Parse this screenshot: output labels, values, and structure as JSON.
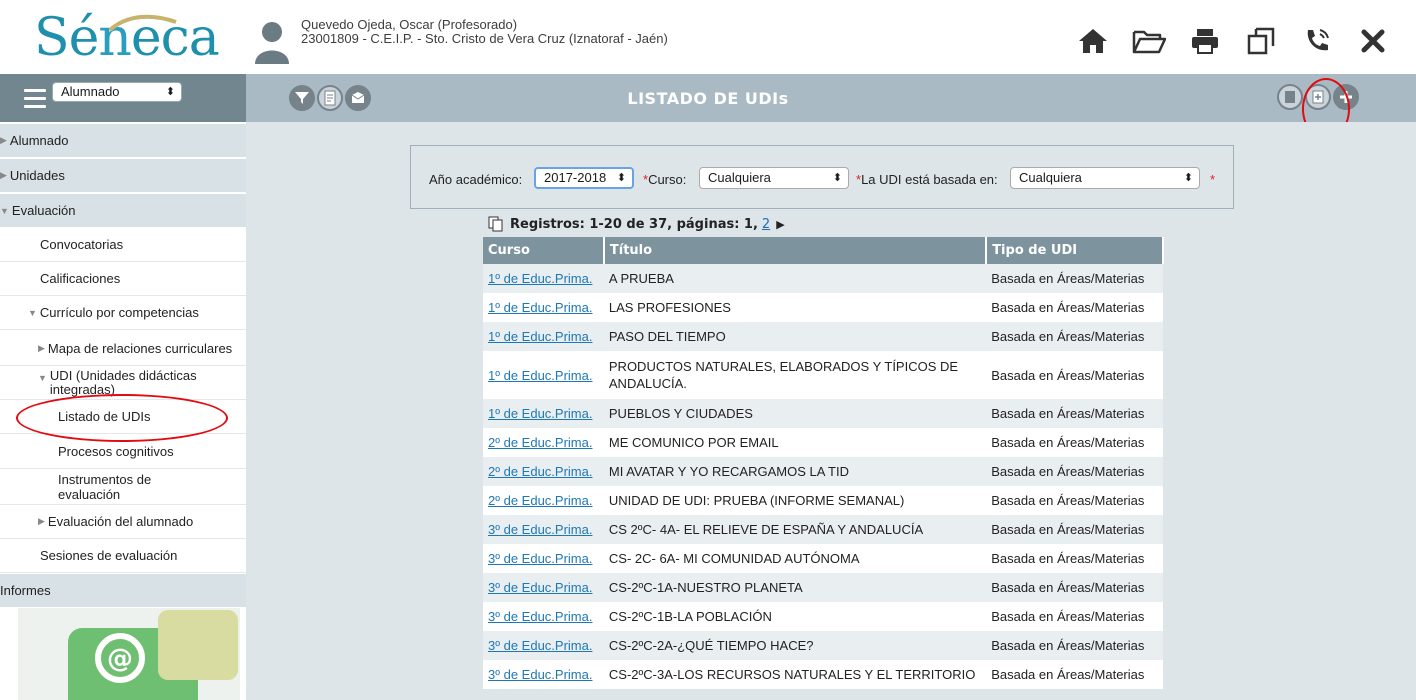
{
  "app": {
    "logo_text": "Séneca"
  },
  "user": {
    "name": "Quevedo Ojeda, Oscar (Profesorado)",
    "center": "23001809 - C.E.I.P. - Sto. Cristo de Vera Cruz (Iznatoraf - Jaén)"
  },
  "header_icons": [
    "home-icon",
    "folder-open-icon",
    "print-icon",
    "windows-icon",
    "phone-icon",
    "close-icon"
  ],
  "toolbar": {
    "module_select": "Alumnado",
    "page_title": "LISTADO DE UDIs",
    "left_tools": [
      "filter-icon",
      "export-pdf-xls-icon",
      "message-icon"
    ],
    "right_tools": [
      "document-icon",
      "new-document-icon",
      "add-icon"
    ]
  },
  "sidebar": {
    "items": [
      {
        "label": "Alumnado"
      },
      {
        "label": "Unidades"
      },
      {
        "label": "Evaluación"
      },
      {
        "label": "Convocatorias"
      },
      {
        "label": "Calificaciones"
      },
      {
        "label": "Currículo por competencias"
      },
      {
        "label": "Mapa de relaciones curriculares"
      },
      {
        "label": "UDI (Unidades didácticas integradas)"
      },
      {
        "label": "Listado de UDIs"
      },
      {
        "label": "Procesos cognitivos"
      },
      {
        "label": "Instrumentos de evaluación"
      },
      {
        "label": "Evaluación del alumnado"
      },
      {
        "label": "Sesiones de evaluación"
      },
      {
        "label": "Informes"
      }
    ]
  },
  "filters": {
    "year_label": "Año académico:",
    "year_value": "2017-2018",
    "course_label": "Curso:",
    "course_value": "Cualquiera",
    "basis_label": "La UDI está basada en:",
    "basis_value": "Cualquiera",
    "required_mark": "*"
  },
  "pager": {
    "text": "Registros: 1-20 de 37, páginas: 1,",
    "next_page": "2"
  },
  "table": {
    "headers": [
      "Curso",
      "Título",
      "Tipo de UDI"
    ],
    "rows": [
      {
        "curso": "1º de Educ.Prima.",
        "titulo": "A PRUEBA",
        "tipo": "Basada en Áreas/Materias"
      },
      {
        "curso": "1º de Educ.Prima.",
        "titulo": "LAS PROFESIONES",
        "tipo": "Basada en Áreas/Materias"
      },
      {
        "curso": "1º de Educ.Prima.",
        "titulo": "PASO DEL TIEMPO",
        "tipo": "Basada en Áreas/Materias"
      },
      {
        "curso": "1º de Educ.Prima.",
        "titulo": "PRODUCTOS NATURALES, ELABORADOS Y TÍPICOS DE ANDALUCÍA.",
        "tipo": "Basada en Áreas/Materias"
      },
      {
        "curso": "1º de Educ.Prima.",
        "titulo": "PUEBLOS Y CIUDADES",
        "tipo": "Basada en Áreas/Materias"
      },
      {
        "curso": "2º de Educ.Prima.",
        "titulo": "ME COMUNICO POR EMAIL",
        "tipo": "Basada en Áreas/Materias"
      },
      {
        "curso": "2º de Educ.Prima.",
        "titulo": "MI AVATAR Y YO RECARGAMOS LA TID",
        "tipo": "Basada en Áreas/Materias"
      },
      {
        "curso": "2º de Educ.Prima.",
        "titulo": "UNIDAD DE UDI: PRUEBA (INFORME SEMANAL)",
        "tipo": "Basada en Áreas/Materias"
      },
      {
        "curso": "3º de Educ.Prima.",
        "titulo": "CS 2ºC- 4A- EL RELIEVE DE ESPAÑA Y ANDALUCÍA",
        "tipo": "Basada en Áreas/Materias"
      },
      {
        "curso": "3º de Educ.Prima.",
        "titulo": "CS- 2C- 6A- MI COMUNIDAD AUTÓNOMA",
        "tipo": "Basada en Áreas/Materias"
      },
      {
        "curso": "3º de Educ.Prima.",
        "titulo": "CS-2ºC-1A-NUESTRO PLANETA",
        "tipo": "Basada en Áreas/Materias"
      },
      {
        "curso": "3º de Educ.Prima.",
        "titulo": "CS-2ºC-1B-LA POBLACIÓN",
        "tipo": "Basada en Áreas/Materias"
      },
      {
        "curso": "3º de Educ.Prima.",
        "titulo": "CS-2ºC-2A-¿QUÉ TIEMPO HACE?",
        "tipo": "Basada en Áreas/Materias"
      },
      {
        "curso": "3º de Educ.Prima.",
        "titulo": "CS-2ºC-3A-LOS RECURSOS NATURALES Y EL TERRITORIO",
        "tipo": "Basada en Áreas/Materias"
      }
    ]
  },
  "colors": {
    "accent": "#1f8fae",
    "annotation": "#e10b10",
    "toolbar": "#a9bac5",
    "table_header": "#7d939e"
  }
}
